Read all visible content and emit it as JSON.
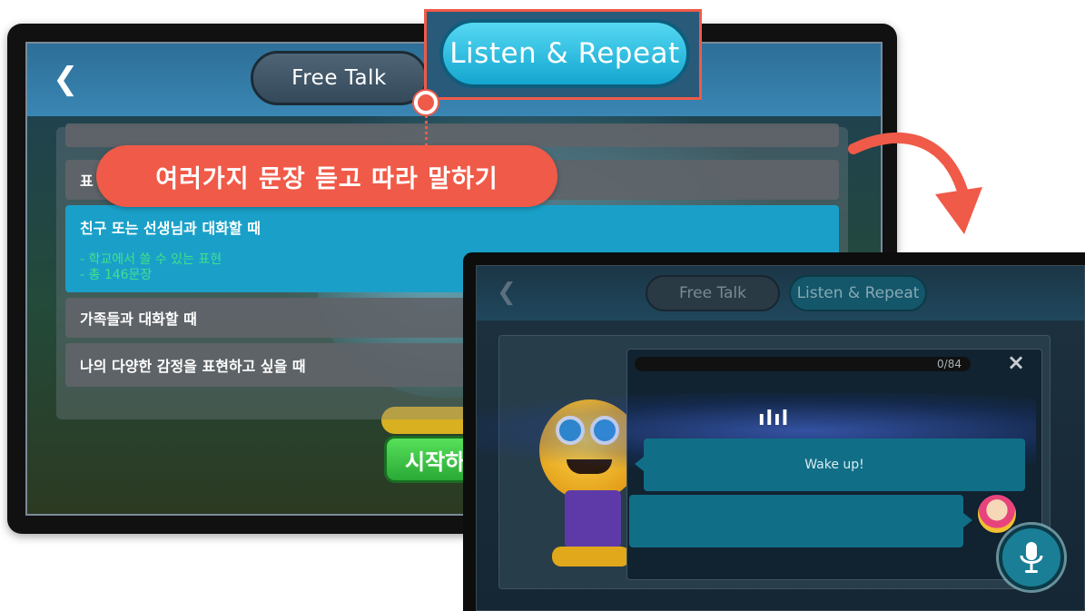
{
  "screen_main": {
    "back_icon": "chevron-left",
    "tab_free_talk": "Free Talk",
    "list_items": [
      {
        "title": "표",
        "cut": false
      },
      {
        "title": "친구 또는 선생님과 대화할 때",
        "sub1": "- 학교에서 쓸 수 있는 표현",
        "sub2": "- 총 146문장",
        "selected": true
      },
      {
        "title": "가족들과 대화할 때"
      },
      {
        "title": "나의 다양한 감정을 표현하고 싶을 때"
      }
    ],
    "start_button": "시작하"
  },
  "callout": {
    "tab_listen_repeat": "Listen & Repeat",
    "description": "여러가지 문장 듣고 따라 말하기",
    "accent_color": "#f05a48"
  },
  "screen_detail": {
    "back_icon": "chevron-left",
    "tab_free_talk": "Free Talk",
    "tab_listen_repeat": "Listen & Repeat",
    "progress_text": "0/84",
    "progress_value": 0,
    "close_icon": "×",
    "waveform": "ılıl",
    "sentence": "Wake up!",
    "mic_icon": "microphone"
  }
}
